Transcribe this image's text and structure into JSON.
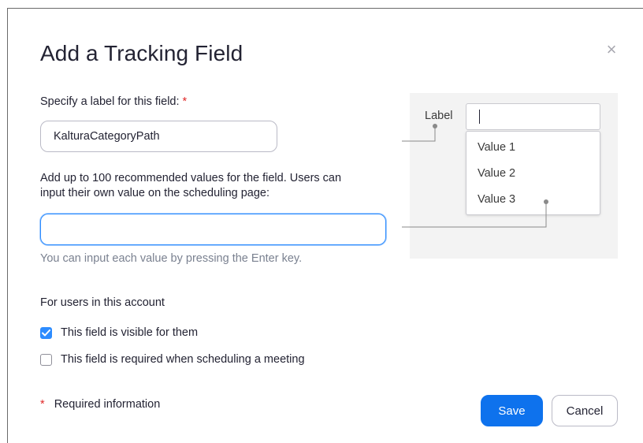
{
  "dialog": {
    "title": "Add a Tracking Field",
    "close_glyph": "×"
  },
  "label_field": {
    "prompt": "Specify a label for this field:",
    "required_marker": "*",
    "value": "KalturaCategoryPath"
  },
  "values_field": {
    "prompt_line1": "Add up to 100 recommended values for the field. Users can",
    "prompt_line2": "input their own value on the scheduling page:",
    "value": "",
    "hint": "You can input each value by pressing the Enter key."
  },
  "preview": {
    "label": "Label",
    "options": [
      "Value 1",
      "Value 2",
      "Value 3"
    ]
  },
  "account_section": {
    "title": "For users in this account",
    "options": [
      {
        "label": "This field is visible for them",
        "checked": true
      },
      {
        "label": "This field is required when scheduling a meeting",
        "checked": false
      }
    ]
  },
  "footer": {
    "required_marker": "*",
    "required_note": "Required information",
    "save_label": "Save",
    "cancel_label": "Cancel"
  },
  "colors": {
    "primary": "#0e72ed",
    "checkbox_checked": "#2d8cff",
    "required": "#e02828"
  },
  "icons": {
    "close": "close-icon",
    "check": "check-icon"
  }
}
